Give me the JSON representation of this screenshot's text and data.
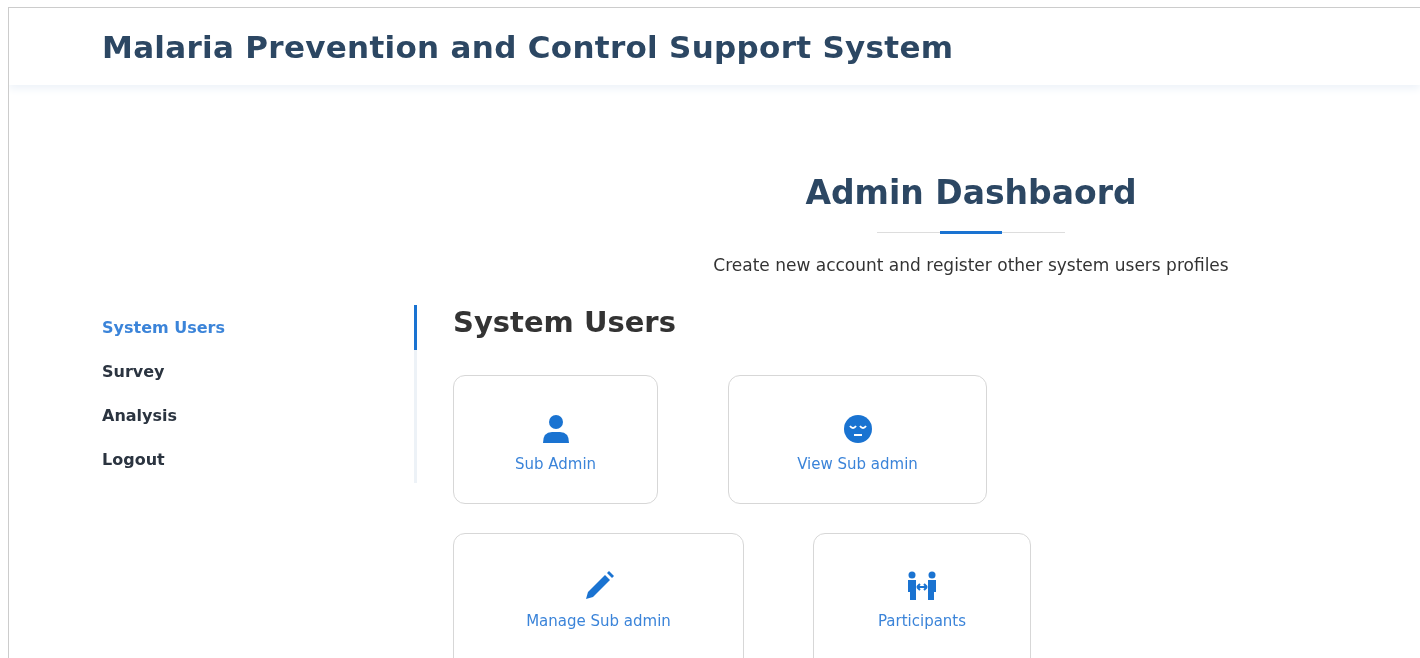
{
  "header": {
    "title": "Malaria Prevention and Control Support System"
  },
  "page": {
    "heading": "Admin Dashbaord",
    "subtitle": "Create new account and register other system users profiles"
  },
  "sidebar": {
    "items": [
      {
        "label": "System Users",
        "selected": true
      },
      {
        "label": "Survey",
        "selected": false
      },
      {
        "label": "Analysis",
        "selected": false
      },
      {
        "label": "Logout",
        "selected": false
      }
    ]
  },
  "section": {
    "title": "System Users"
  },
  "cards": [
    {
      "kind": "person",
      "label": "Sub Admin"
    },
    {
      "kind": "face",
      "label": "View Sub admin"
    },
    {
      "kind": "pencil",
      "label": "Manage Sub admin"
    },
    {
      "kind": "people",
      "label": "Participants"
    }
  ]
}
